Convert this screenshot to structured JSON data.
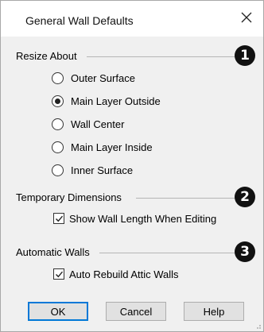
{
  "window": {
    "title": "General Wall Defaults",
    "close_icon": "close-icon"
  },
  "resize_about": {
    "label": "Resize About",
    "callout": "1",
    "options": [
      {
        "label": "Outer Surface",
        "checked": false
      },
      {
        "label": "Main Layer Outside",
        "checked": true
      },
      {
        "label": "Wall Center",
        "checked": false
      },
      {
        "label": "Main Layer Inside",
        "checked": false
      },
      {
        "label": "Inner Surface",
        "checked": false
      }
    ]
  },
  "temporary_dimensions": {
    "label": "Temporary Dimensions",
    "callout": "2",
    "checkbox_label": "Show Wall Length When Editing",
    "checked": true
  },
  "automatic_walls": {
    "label": "Automatic Walls",
    "callout": "3",
    "checkbox_label": "Auto Rebuild Attic Walls",
    "checked": true
  },
  "buttons": {
    "ok": "OK",
    "cancel": "Cancel",
    "help": "Help"
  },
  "colors": {
    "default_button_border": "#0078d7",
    "callout_bg": "#111111"
  }
}
